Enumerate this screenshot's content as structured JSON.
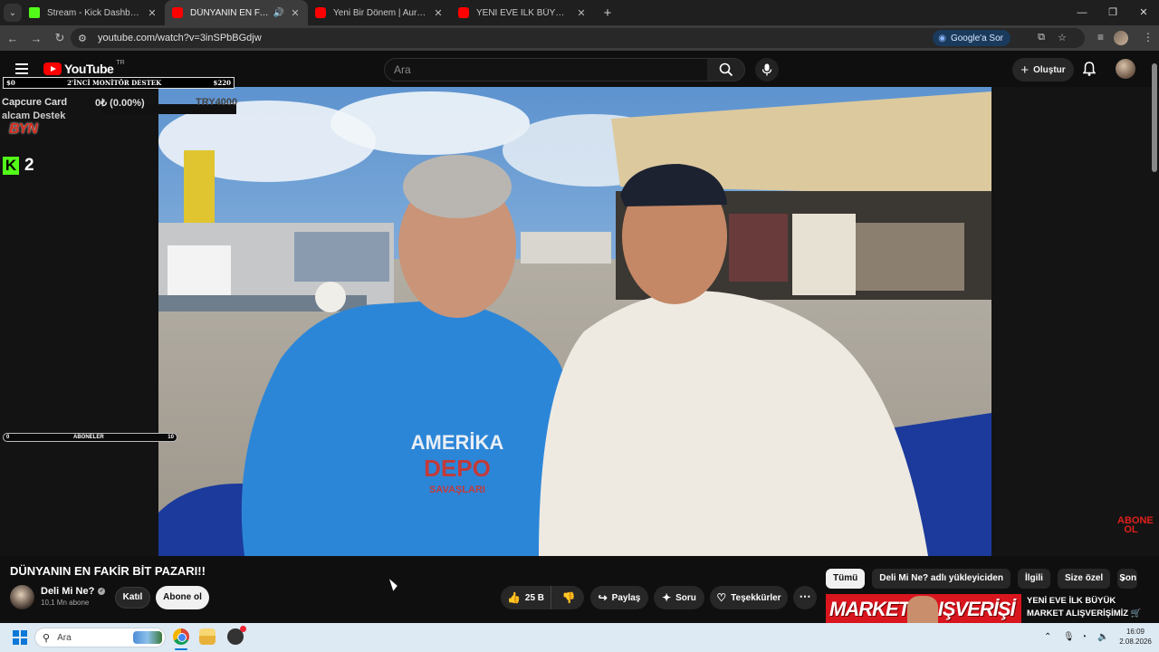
{
  "browser": {
    "tabs": [
      {
        "title": "Stream - Kick Dashboard",
        "favicon": "kick-icon",
        "active": false
      },
      {
        "title": "DÜNYANIN EN FAKİR BİT PAZARI!!",
        "favicon": "youtube-icon",
        "active": true,
        "audio": true
      },
      {
        "title": "Yeni Bir Dönem | Aurora Vlog",
        "favicon": "youtube-icon",
        "active": false
      },
      {
        "title": "YENİ EVE İLK BÜYÜK MARKET ALIŞVERİŞİMİZ",
        "favicon": "youtube-icon",
        "active": false
      }
    ],
    "url": "youtube.com/watch?v=3inSPbBGdjw",
    "google_ask": "Google'a Sor"
  },
  "youtube": {
    "logo_text": "YouTube",
    "country_code": "TR",
    "search_placeholder": "Ara",
    "create_label": "Oluştur"
  },
  "overlays": {
    "goal_start": "$0",
    "goal_title": "2'İNCİ MONİTÖR DESTEK",
    "goal_target": "$220",
    "capcure_label": "Capcure Card",
    "capcure_progress": "0₺ (0.00%)",
    "capcure_target": "TRY4000",
    "alcam_text": "alcam Destek",
    "logo_text": "BYN",
    "kick_viewers": "2",
    "subs_min": "0",
    "subs_label": "ABONELER",
    "subs_max": "10",
    "watermark": "ABONE OL"
  },
  "video": {
    "title": "DÜNYANIN EN FAKİR BİT PAZARI!!",
    "channel": "Deli Mi Ne?",
    "subscribers": "10,1 Mn abone",
    "join_label": "Katıl",
    "subscribe_label": "Abone ol",
    "likes": "25 B",
    "share_label": "Paylaş",
    "ask_label": "Soru",
    "thanks_label": "Teşekkürler",
    "shirt_text_1": "AMERİKA",
    "shirt_text_2": "DEPO",
    "shirt_text_3": "SAVAŞLARI"
  },
  "sidebar": {
    "chips": [
      "Tümü",
      "Deli Mi Ne? adlı yükleyiciden",
      "İlgili",
      "Size özel",
      "Son"
    ],
    "rec_thumb_text": "MARKET ALIŞVERİŞİ",
    "rec_title": "YENİ EVE İLK BÜYÜK MARKET ALIŞVERİŞİMİZ 🛒"
  },
  "taskbar": {
    "search_placeholder": "Ara",
    "time": "16:09",
    "date": "2.08.2026"
  }
}
